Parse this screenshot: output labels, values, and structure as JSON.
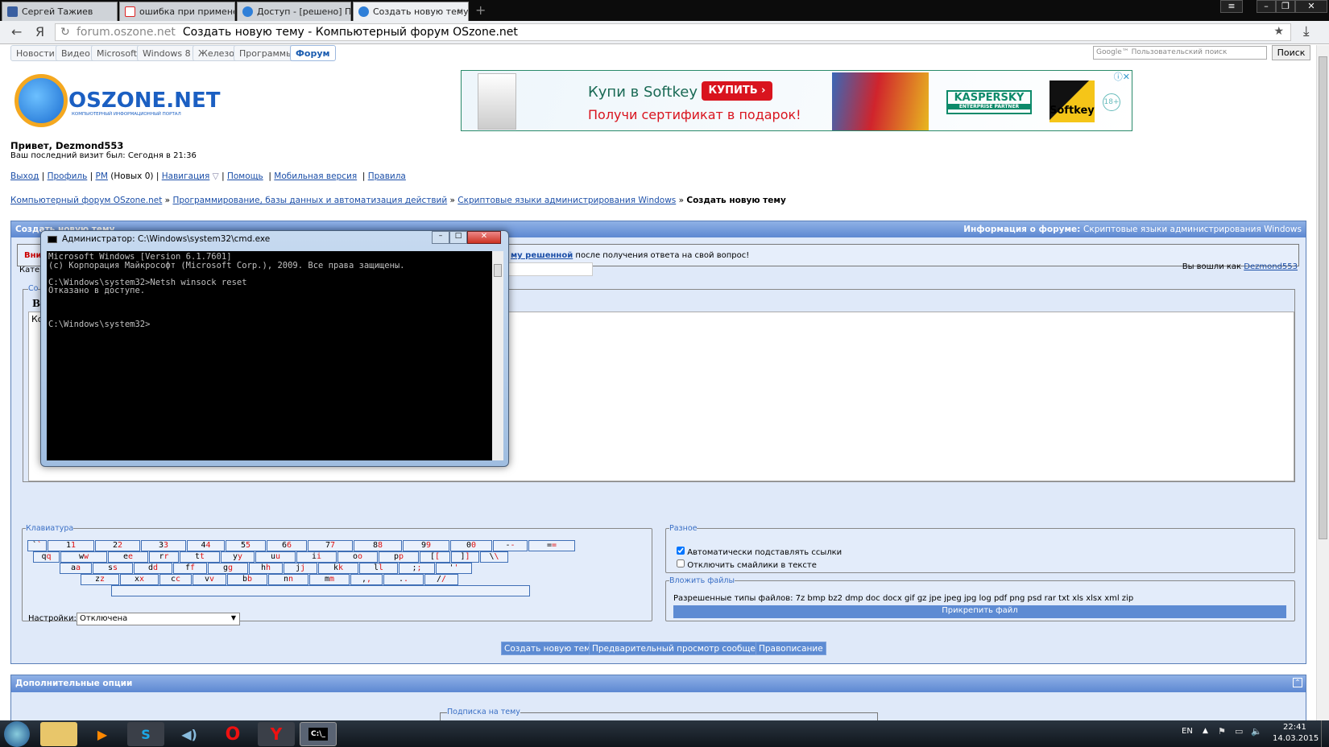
{
  "browser": {
    "tabs": [
      {
        "label": "Сергей Тажиев"
      },
      {
        "label": "ошибка при примене"
      },
      {
        "label": "Доступ - [решено] Пр"
      },
      {
        "label": "Создать новую тему -",
        "close": "×"
      }
    ],
    "new_tab": "+",
    "url_domain": "forum.oszone.net",
    "url_title": "Создать новую тему - Компьютерный форум OSzone.net",
    "back": "←",
    "yandex": "Я",
    "reload": "↻",
    "star": "★",
    "download": "⤓",
    "window_controls": {
      "menu": "≡",
      "minimize": "–",
      "restore": "❐",
      "close": "✕"
    }
  },
  "site_nav": [
    "Новости",
    "Видео",
    "Microsoft",
    "Windows 8",
    "Железо",
    "Программы",
    "Форум"
  ],
  "search": {
    "placeholder": "Google™ Пользовательский поиск",
    "button": "Поиск"
  },
  "logo": {
    "text": "OSZONE.NET",
    "tagline": "КОМПЬЮТЕРНЫЙ ИНФОРМАЦИОННЫЙ ПОРТАЛ"
  },
  "ad": {
    "headline": "Купи в Softkey",
    "buy": "КУПИТЬ ›",
    "sub": "Получи сертификат в подарок!",
    "kaspersky": "KASPERSKY",
    "partner": "ENTERPRISE PARTNER",
    "softkey": "Softkey",
    "age": "18+"
  },
  "user": {
    "greeting": "Привет, Dezmond553",
    "last_visit": "Ваш последний визит был: Сегодня в 21:36"
  },
  "user_links": {
    "logout": "Выход",
    "profile": "Профиль",
    "pm": "PM",
    "pm_count": "(Новых 0)",
    "navigation": "Навигация",
    "help": "Помощь",
    "mobile": "Мобильная версия",
    "rules": "Правила"
  },
  "breadcrumb": [
    "Компьютерный форум OSzone.net",
    "Программирование, базы данных и автоматизация действий",
    "Скриптовые языки администрирования Windows"
  ],
  "breadcrumb_current": "Создать новую тему",
  "panel": {
    "title": "Создать новую тему",
    "info_label": "Информация о форуме:",
    "info_value": "Скриптовые языки администрирования Windows",
    "warning_start": "Вни",
    "warning_link": "му решенной",
    "warning_rest": "после получения ответа на свой вопрос!",
    "category_label": "Кате",
    "logged_as": "Вы вошли как",
    "username": "Dezmond553",
    "editor_legend": "Со",
    "bold": "B",
    "textarea_start": "Ко"
  },
  "keyboard": {
    "legend": "Клавиатура",
    "rows": [
      [
        "`",
        "1",
        "2",
        "3",
        "4",
        "5",
        "6",
        "7",
        "8",
        "9",
        "0",
        "-",
        "="
      ],
      [
        "q",
        "w",
        "e",
        "r",
        "t",
        "y",
        "u",
        "i",
        "o",
        "p",
        "[",
        "]",
        "\\"
      ],
      [
        "a",
        "s",
        "d",
        "f",
        "g",
        "h",
        "j",
        "k",
        "l",
        ";",
        "'"
      ],
      [
        "z",
        "x",
        "c",
        "v",
        "b",
        "n",
        "m",
        ",",
        ".",
        "/"
      ]
    ],
    "settings_label": "Настройки:",
    "settings_value": "Отключена"
  },
  "misc": {
    "legend": "Разное",
    "auto_links": "Автоматически подставлять ссылки",
    "auto_links_checked": true,
    "disable_smilies": "Отключить смайлики в тексте",
    "disable_smilies_checked": false
  },
  "attach": {
    "legend": "Вложить файлы",
    "types": "Разрешенные типы файлов: 7z bmp bz2 dmp doc docx gif gz jpe jpeg jpg log pdf png psd rar txt xls xlsx xml zip",
    "button": "Прикрепить файл"
  },
  "actions": {
    "submit": "Создать новую тему",
    "preview": "Предварительный просмотр сообщения",
    "spell": "Правописание"
  },
  "extra": {
    "title": "Дополнительные опции",
    "subscribe_legend": "Подписка на тему"
  },
  "cmd": {
    "title": "Администратор: C:\\Windows\\system32\\cmd.exe",
    "output": "Microsoft Windows [Version 6.1.7601]\n(c) Корпорация Майкрософт (Microsoft Corp.), 2009. Все права защищены.\n\nC:\\Windows\\system32>Netsh winsock reset\nОтказано в доступе.\n\n\n\nC:\\Windows\\system32>"
  },
  "taskbar": {
    "lang": "EN",
    "time": "22:41",
    "date": "14.03.2015",
    "cmd_icon": "C:\\_"
  }
}
